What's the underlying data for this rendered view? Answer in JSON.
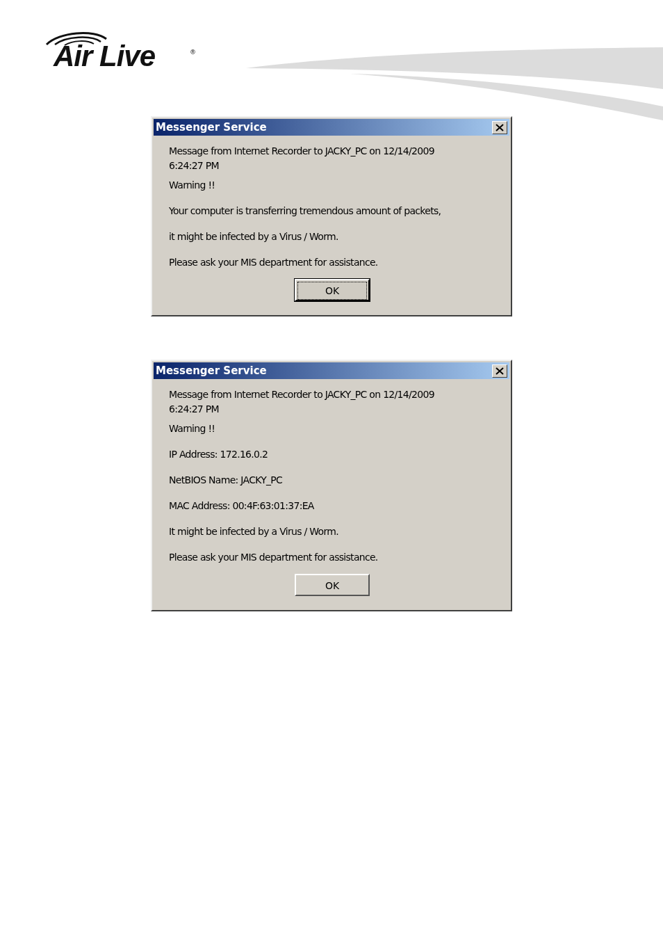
{
  "header": {
    "logo": "Air Live",
    "logo_mark": "®"
  },
  "dialogs": [
    {
      "title": "Messenger Service",
      "paragraphs": [
        "Message from Internet Recorder to JACKY_PC on 12/14/2009 6:24:27 PM",
        "Warning !!",
        "Your computer is transferring tremendous amount of packets,",
        "it might be infected by a Virus / Worm.",
        "Please ask your MIS department for assistance."
      ],
      "button": {
        "label": "OK",
        "focused": true
      }
    },
    {
      "title": "Messenger Service",
      "paragraphs": [
        "Message from Internet Recorder to JACKY_PC on 12/14/2009 6:24:27 PM",
        "Warning !!",
        "IP Address: 172.16.0.2",
        "NetBIOS Name: JACKY_PC",
        "MAC Address: 00:4F:63:01:37:EA",
        "It might be infected by a Virus / Worm.",
        "Please ask your MIS department for assistance."
      ],
      "button": {
        "label": "OK",
        "focused": false
      }
    }
  ]
}
